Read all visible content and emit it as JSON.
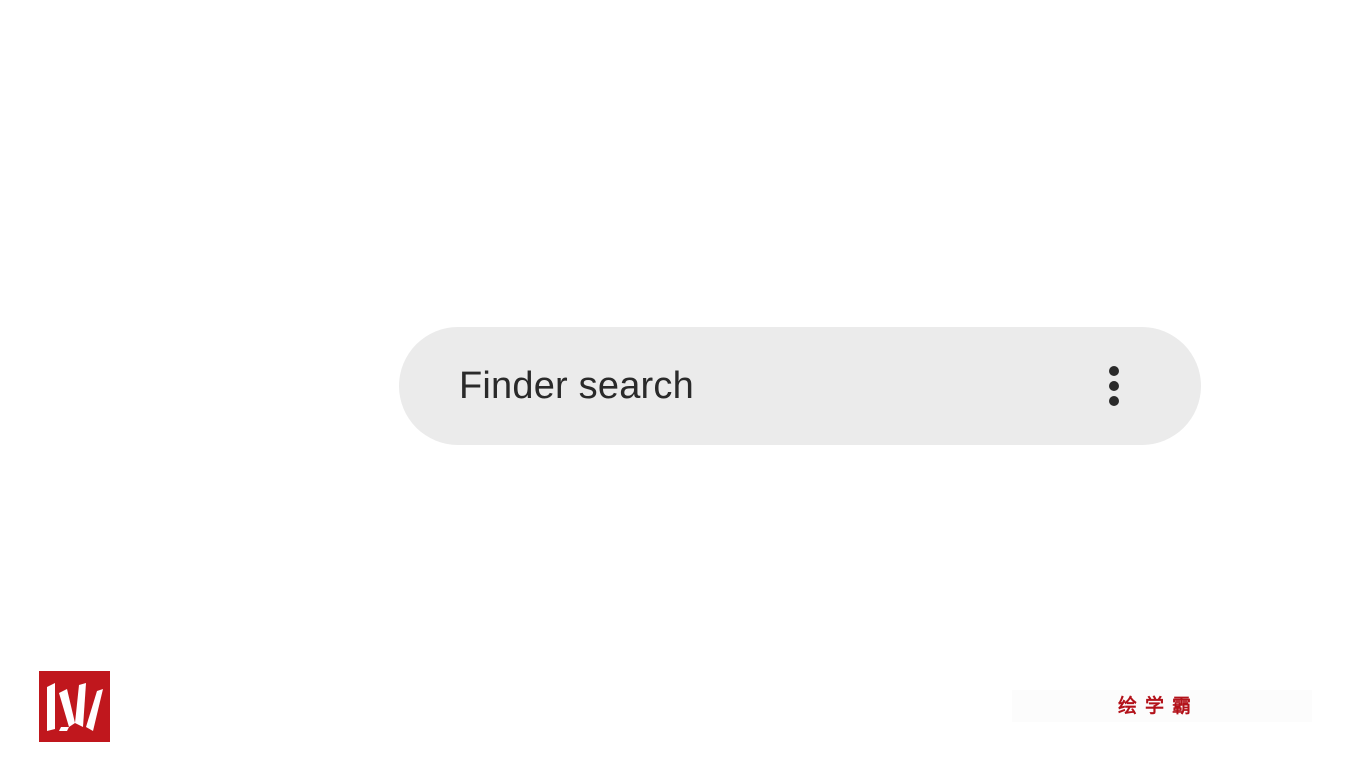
{
  "search": {
    "label": "Finder search",
    "more_icon": "more-vertical-icon"
  },
  "branding": {
    "logo_icon": "w-logo-icon",
    "watermark_text": "绘学霸",
    "logo_color": "#c0171d",
    "watermark_color": "#b3121a"
  },
  "colors": {
    "background": "#ffffff",
    "search_bar": "#ebebeb",
    "text": "#2a2a2a"
  }
}
